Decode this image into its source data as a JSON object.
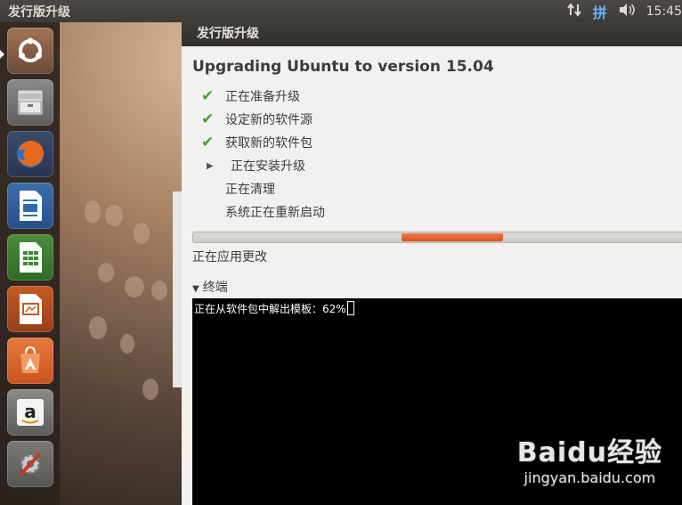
{
  "topbar": {
    "title": "发行版升级",
    "network_icon": "transfer-arrows-icon",
    "input_method": "拼",
    "volume_icon": "speaker-icon",
    "clock": "15:45"
  },
  "launcher": {
    "items": [
      {
        "name": "ubuntu-dash-icon"
      },
      {
        "name": "file-manager-icon"
      },
      {
        "name": "firefox-icon"
      },
      {
        "name": "writer-icon"
      },
      {
        "name": "calc-icon"
      },
      {
        "name": "impress-icon"
      },
      {
        "name": "software-center-icon"
      },
      {
        "name": "amazon-icon",
        "label": "a"
      },
      {
        "name": "system-settings-icon"
      }
    ]
  },
  "window": {
    "title": "发行版升级",
    "heading": "Upgrading Ubuntu to version 15.04",
    "steps": [
      {
        "label": "正在准备升级",
        "state": "done"
      },
      {
        "label": "设定新的软件源",
        "state": "done"
      },
      {
        "label": "获取新的软件包",
        "state": "done"
      },
      {
        "label": "正在安装升级",
        "state": "current"
      },
      {
        "label": "正在清理",
        "state": "pending"
      },
      {
        "label": "系统正在重新启动",
        "state": "pending"
      }
    ],
    "status": "正在应用更改",
    "terminal_label": "终端",
    "terminal_text": "正在从软件包中解出模板：62%"
  },
  "watermark": {
    "logo": "Baidu经验",
    "url": "jingyan.baidu.com"
  },
  "colors": {
    "accent": "#e0622b",
    "check": "#4aa02c",
    "panel": "#3c3b37"
  }
}
